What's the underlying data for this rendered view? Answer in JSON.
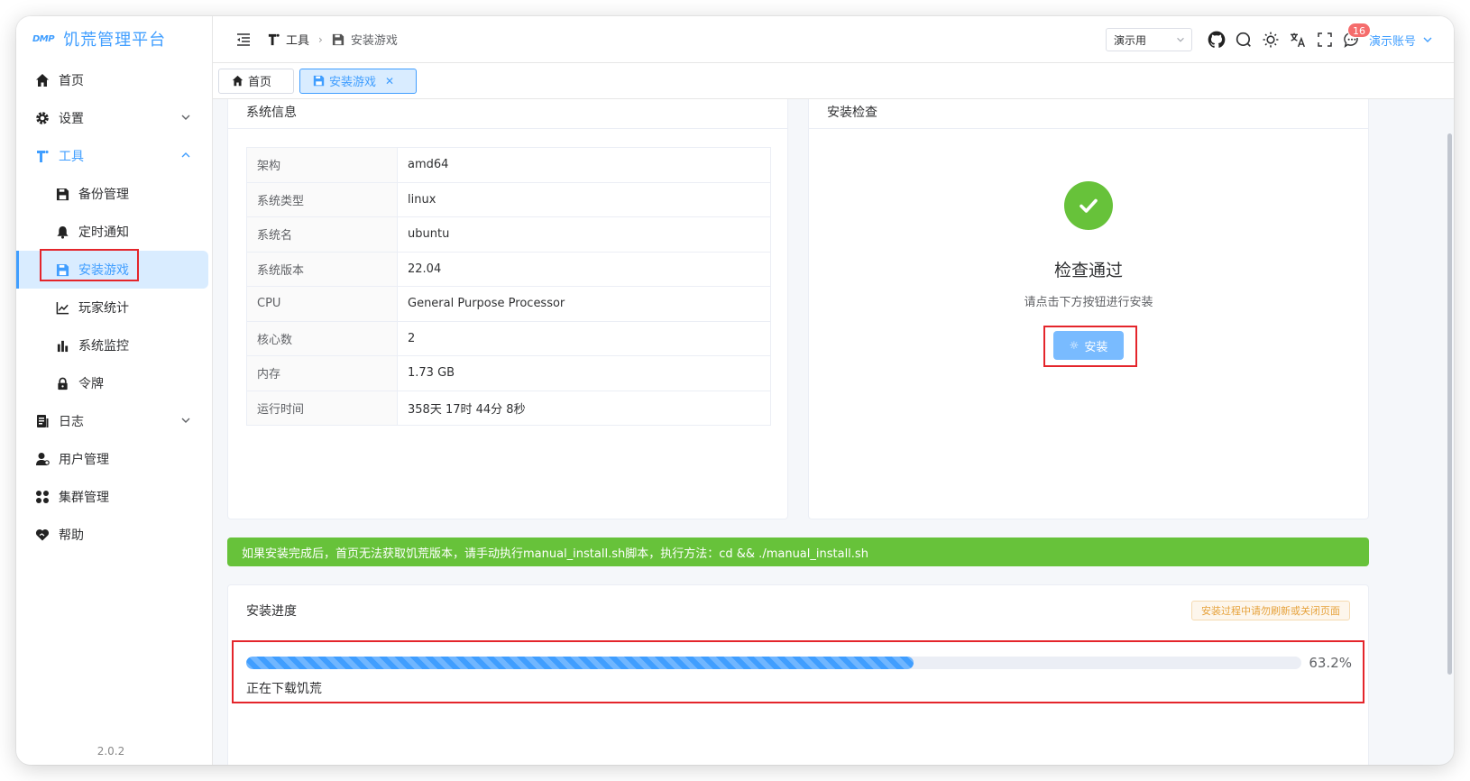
{
  "app": {
    "logo_mark": "DMP",
    "title": "饥荒管理平台",
    "version": "2.0.2"
  },
  "sidebar": {
    "items": [
      {
        "label": "首页"
      },
      {
        "label": "设置"
      },
      {
        "label": "工具"
      },
      {
        "label": "备份管理"
      },
      {
        "label": "定时通知"
      },
      {
        "label": "安装游戏"
      },
      {
        "label": "玩家统计"
      },
      {
        "label": "系统监控"
      },
      {
        "label": "令牌"
      },
      {
        "label": "日志"
      },
      {
        "label": "用户管理"
      },
      {
        "label": "集群管理"
      },
      {
        "label": "帮助"
      }
    ]
  },
  "header": {
    "breadcrumb": [
      {
        "label": "工具"
      },
      {
        "label": "安装游戏"
      }
    ],
    "select_value": "演示用",
    "notification_count": "16",
    "account_label": "演示账号"
  },
  "tabs": [
    {
      "label": "首页"
    },
    {
      "label": "安装游戏"
    }
  ],
  "sysinfo": {
    "title": "系统信息",
    "rows": [
      {
        "key": "架构",
        "value": "amd64"
      },
      {
        "key": "系统类型",
        "value": "linux"
      },
      {
        "key": "系统名",
        "value": "ubuntu"
      },
      {
        "key": "系统版本",
        "value": "22.04"
      },
      {
        "key": "CPU",
        "value": "General Purpose Processor"
      },
      {
        "key": "核心数",
        "value": "2"
      },
      {
        "key": "内存",
        "value": "1.73 GB"
      },
      {
        "key": "运行时间",
        "value": "358天 17时 44分 8秒"
      }
    ]
  },
  "install_check": {
    "title": "安装检查",
    "result_title": "检查通过",
    "result_subtitle": "请点击下方按钮进行安装",
    "install_button": "安装"
  },
  "alert": {
    "text": "如果安装完成后，首页无法获取饥荒版本，请手动执行manual_install.sh脚本，执行方法：cd && ./manual_install.sh"
  },
  "progress": {
    "title": "安装进度",
    "warning": "安装过程中请勿刷新或关闭页面",
    "percent": 63.2,
    "percent_text": "63.2%",
    "status": "正在下载饥荒"
  },
  "colors": {
    "accent": "#409eff",
    "success": "#67c23a",
    "warning": "#e6a23c",
    "highlight": "#e4252b"
  }
}
